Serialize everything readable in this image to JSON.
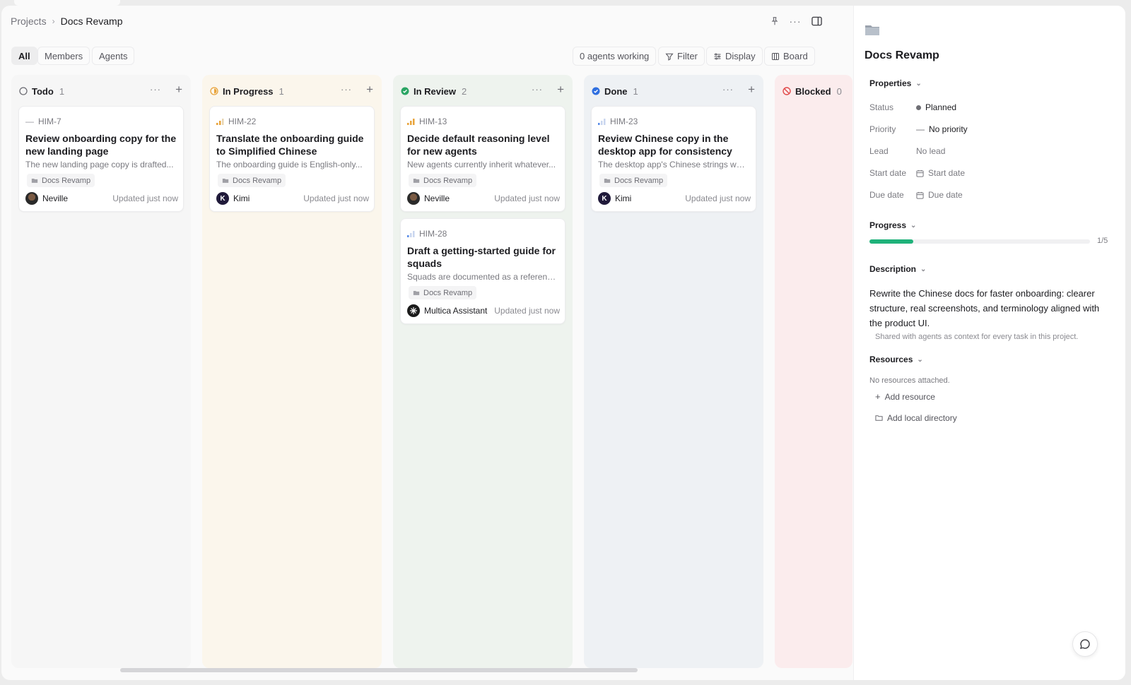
{
  "breadcrumb": {
    "parent": "Projects",
    "current": "Docs Revamp"
  },
  "view_tabs": [
    "All",
    "Members",
    "Agents"
  ],
  "toolbar": {
    "agents_working": "0 agents working",
    "filter": "Filter",
    "display": "Display",
    "board": "Board"
  },
  "columns": [
    {
      "title": "Todo",
      "count": "1",
      "icon": "circle-outline-icon",
      "color": "#8a8a90"
    },
    {
      "title": "In Progress",
      "count": "1",
      "icon": "half-circle-icon",
      "color": "#e8a33a"
    },
    {
      "title": "In Review",
      "count": "2",
      "icon": "check-circle-green-icon",
      "color": "#2aa564"
    },
    {
      "title": "Done",
      "count": "1",
      "icon": "check-circle-blue-icon",
      "color": "#2f6fe0"
    },
    {
      "title": "Blocked",
      "count": "0",
      "icon": "blocked-icon",
      "color": "#e14b4b"
    }
  ],
  "cards": {
    "todo": [
      {
        "id": "HIM-7",
        "priority": "no-priority-icon",
        "title": "Review onboarding copy for the new landing page",
        "desc": "The new landing page copy is drafted...",
        "tag": "Docs Revamp",
        "assignee": "Neville",
        "updated": "Updated just now"
      }
    ],
    "progress": [
      {
        "id": "HIM-22",
        "priority": "high-priority-icon",
        "title": "Translate the onboarding guide to Simplified Chinese",
        "desc": "The onboarding guide is English-only...",
        "tag": "Docs Revamp",
        "assignee": "Kimi",
        "avatar_letter": "K",
        "updated": "Updated just now"
      }
    ],
    "review": [
      {
        "id": "HIM-13",
        "priority": "high-priority-icon",
        "title": "Decide default reasoning level for new agents",
        "desc": "New agents currently inherit whatever...",
        "tag": "Docs Revamp",
        "assignee": "Neville",
        "updated": "Updated just now"
      },
      {
        "id": "HIM-28",
        "priority": "low-priority-icon",
        "title": "Draft a getting-started guide for squads",
        "desc": "Squads are documented as a reference...",
        "tag": "Docs Revamp",
        "assignee": "Multica Assistant",
        "updated": "Updated just now"
      }
    ],
    "done": [
      {
        "id": "HIM-23",
        "priority": "low-priority-icon",
        "title": "Review Chinese copy in the desktop app for consistency",
        "desc": "The desktop app's Chinese strings wer...",
        "tag": "Docs Revamp",
        "assignee": "Kimi",
        "avatar_letter": "K",
        "updated": "Updated just now"
      }
    ]
  },
  "panel": {
    "title": "Docs Revamp",
    "properties_label": "Properties",
    "status_label": "Status",
    "status_value": "Planned",
    "priority_label": "Priority",
    "priority_value": "No priority",
    "lead_label": "Lead",
    "lead_value": "No lead",
    "start_label": "Start date",
    "start_value": "Start date",
    "due_label": "Due date",
    "due_value": "Due date",
    "progress_label": "Progress",
    "progress_value": 0.2,
    "progress_text": "1/5",
    "description_label": "Description",
    "description": "Rewrite the Chinese docs for faster onboarding: clearer structure, real screenshots, and terminology aligned with the product UI.",
    "description_note": "Shared with agents as context for every task in this project.",
    "resources_label": "Resources",
    "resources_empty": "No resources attached.",
    "add_resource": "Add resource",
    "add_local_dir": "Add local directory"
  },
  "colors": {
    "accent_progress": "#1fb27a"
  }
}
